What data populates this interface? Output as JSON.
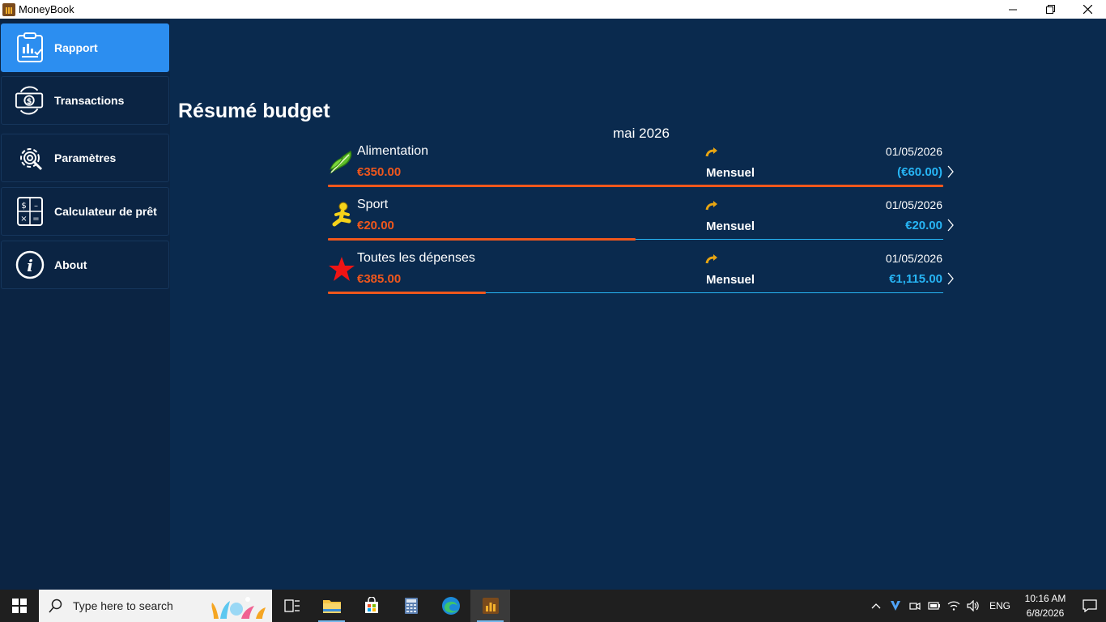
{
  "window": {
    "title": "MoneyBook",
    "minimize_icon": "minimize-icon",
    "restore_icon": "restore-icon",
    "close_icon": "close-icon"
  },
  "sidebar": {
    "items": [
      {
        "label": "Rapport",
        "icon": "report-clipboard-icon",
        "active": true
      },
      {
        "label": "Transactions",
        "icon": "money-exchange-icon",
        "active": false
      },
      {
        "label": "Paramètres",
        "icon": "settings-gear-icon",
        "active": false
      },
      {
        "label": "Calculateur de prêt",
        "icon": "calculator-icon",
        "active": false
      },
      {
        "label": "About",
        "icon": "info-icon",
        "active": false
      }
    ]
  },
  "main": {
    "title": "Résumé budget",
    "month": "mai 2026",
    "budgets": [
      {
        "name": "Alimentation",
        "icon": "lettuce-icon",
        "spent": "€350.00",
        "period": "Mensuel",
        "date": "01/05/2026",
        "remaining": "(€60.00)",
        "progress": 1.0
      },
      {
        "name": "Sport",
        "icon": "runner-icon",
        "spent": "€20.00",
        "period": "Mensuel",
        "date": "01/05/2026",
        "remaining": "€20.00",
        "progress": 0.5
      },
      {
        "name": "Toutes les dépenses",
        "icon": "star-icon",
        "spent": "€385.00",
        "period": "Mensuel",
        "date": "01/05/2026",
        "remaining": "€1,115.00",
        "progress": 0.2567
      }
    ]
  },
  "taskbar": {
    "search_placeholder": "Type here to search",
    "language": "ENG",
    "time": "10:16 AM",
    "date": "6/8/2026"
  },
  "colors": {
    "background": "#0a2a4e",
    "sidebar": "#0b2443",
    "accent": "#2c8ef0",
    "spent": "#f0571c",
    "remaining": "#27b5f5"
  }
}
